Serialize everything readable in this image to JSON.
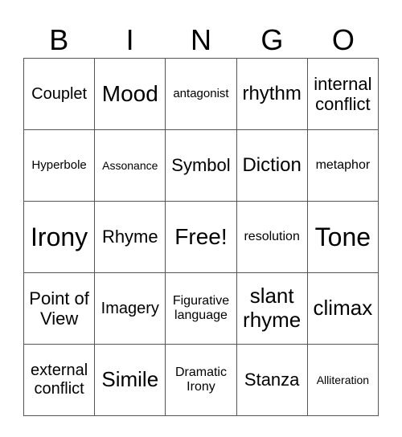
{
  "header": [
    "B",
    "I",
    "N",
    "G",
    "O"
  ],
  "rows": [
    [
      {
        "text": "Couplet",
        "size": "s20"
      },
      {
        "text": "Mood",
        "size": "s28"
      },
      {
        "text": "antagonist",
        "size": "s15"
      },
      {
        "text": "rhythm",
        "size": "s24"
      },
      {
        "text": "internal conflict",
        "size": "s22"
      }
    ],
    [
      {
        "text": "Hyperbole",
        "size": "s15"
      },
      {
        "text": "Assonance",
        "size": "s14"
      },
      {
        "text": "Symbol",
        "size": "s22"
      },
      {
        "text": "Diction",
        "size": "s24"
      },
      {
        "text": "metaphor",
        "size": "s16"
      }
    ],
    [
      {
        "text": "Irony",
        "size": "s32"
      },
      {
        "text": "Rhyme",
        "size": "s22"
      },
      {
        "text": "Free!",
        "size": "s28"
      },
      {
        "text": "resolution",
        "size": "s16"
      },
      {
        "text": "Tone",
        "size": "s32"
      }
    ],
    [
      {
        "text": "Point of View",
        "size": "s22"
      },
      {
        "text": "Imagery",
        "size": "s20"
      },
      {
        "text": "Figurative language",
        "size": "s16"
      },
      {
        "text": "slant rhyme",
        "size": "s26"
      },
      {
        "text": "climax",
        "size": "s26"
      }
    ],
    [
      {
        "text": "external conflict",
        "size": "s20"
      },
      {
        "text": "Simile",
        "size": "s26"
      },
      {
        "text": "Dramatic Irony",
        "size": "s16"
      },
      {
        "text": "Stanza",
        "size": "s22"
      },
      {
        "text": "Alliteration",
        "size": "s14"
      }
    ]
  ]
}
